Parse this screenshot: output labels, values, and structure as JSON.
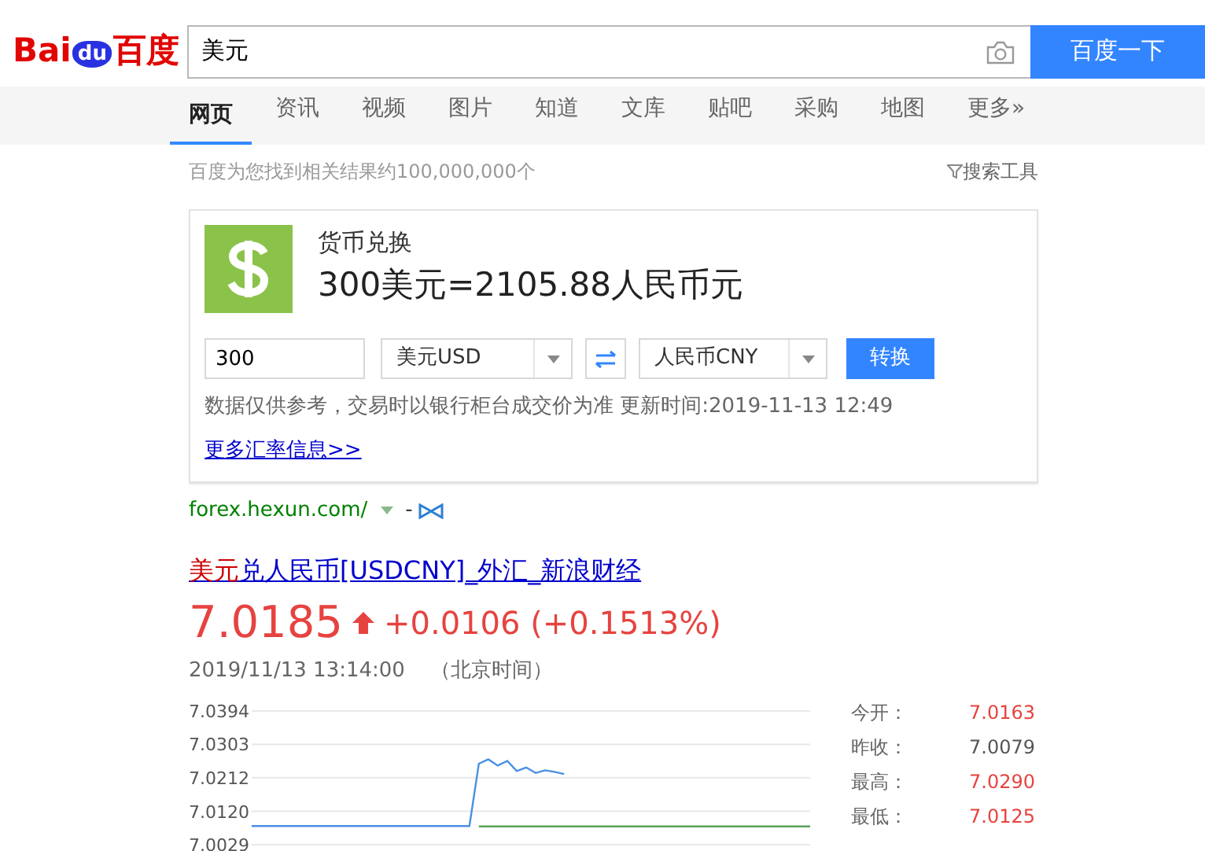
{
  "logo": {
    "parts": [
      "Bai",
      "du",
      "百度"
    ]
  },
  "search": {
    "value": "美元",
    "button": "百度一下"
  },
  "nav_tabs": [
    {
      "label": "网页",
      "selected": true
    },
    {
      "label": "资讯",
      "selected": false
    },
    {
      "label": "视频",
      "selected": false
    },
    {
      "label": "图片",
      "selected": false
    },
    {
      "label": "知道",
      "selected": false
    },
    {
      "label": "文库",
      "selected": false
    },
    {
      "label": "贴吧",
      "selected": false
    },
    {
      "label": "采购",
      "selected": false
    },
    {
      "label": "地图",
      "selected": false
    },
    {
      "label": "更多»",
      "selected": false
    }
  ],
  "result_count": "百度为您找到相关结果约100,000,000个",
  "search_tools": "搜索工具",
  "converter": {
    "title": "货币兑换",
    "result": "300美元=2105.88人民币元",
    "amount": "300",
    "from": "美元USD",
    "to": "人民币CNY",
    "button": "转换",
    "note": "数据仅供参考，交易时以银行柜台成交价为准 更新时间:2019-11-13 12:49",
    "more_link": "更多汇率信息>>"
  },
  "source": {
    "url": "forex.hexun.com/",
    "sep": "-"
  },
  "result": {
    "title": "**美元**兑人民币[USDCNY]_外汇_新浪财经",
    "price": "7.0185",
    "change": "+0.0106 (+0.1513%)",
    "time": "2019/11/13 13:14:00",
    "timezone": "（北京时间）",
    "chart_data": {
      "type": "line",
      "grid": true,
      "ylim": [
        7.0029,
        7.0394
      ],
      "yticks": [
        {
          "value": 7.0394,
          "label": "7.0394"
        },
        {
          "value": 7.0303,
          "label": "7.0303"
        },
        {
          "value": 7.0212,
          "label": "7.0212"
        },
        {
          "value": 7.012,
          "label": "7.0120"
        },
        {
          "value": 7.0029,
          "label": "7.0029"
        }
      ],
      "series": [
        {
          "color": "#4a90e2",
          "values": [
            7.008,
            7.008,
            7.008,
            7.008,
            7.008,
            7.008,
            7.008,
            7.008,
            7.008,
            7.008,
            7.008,
            7.008,
            7.008,
            7.008,
            7.008,
            7.008,
            7.008,
            7.008,
            7.008,
            7.008,
            7.008,
            7.008,
            7.008,
            7.008,
            7.025,
            7.0262,
            7.0245,
            7.0258,
            7.023,
            7.024,
            7.0225,
            7.0232,
            7.0228,
            7.0222,
            null,
            null,
            null,
            null,
            null,
            null,
            null,
            null,
            null,
            null,
            null,
            null,
            null,
            null,
            null,
            null,
            null,
            null,
            null,
            null,
            null,
            null,
            null,
            null,
            null,
            null
          ]
        },
        {
          "color": "#5aa05a",
          "values": [
            null,
            null,
            null,
            null,
            null,
            null,
            null,
            null,
            null,
            null,
            null,
            null,
            null,
            null,
            null,
            null,
            null,
            null,
            null,
            null,
            null,
            null,
            null,
            null,
            7.0079,
            7.0079,
            7.0079,
            7.0079,
            7.0079,
            7.0079,
            7.0079,
            7.0079,
            7.0079,
            7.0079,
            7.0079,
            7.0079,
            7.0079,
            7.0079,
            7.0079,
            7.0079,
            7.0079,
            7.0079,
            7.0079,
            7.0079,
            7.0079,
            7.0079,
            7.0079,
            7.0079,
            7.0079,
            7.0079,
            7.0079,
            7.0079,
            7.0079,
            7.0079,
            7.0079,
            7.0079,
            7.0079,
            7.0079,
            7.0079,
            7.0079
          ]
        }
      ]
    },
    "stats": [
      {
        "label": "今开：",
        "value": "7.0163",
        "up": true
      },
      {
        "label": "昨收：",
        "value": "7.0079",
        "up": false
      },
      {
        "label": "最高：",
        "value": "7.0290",
        "up": true
      },
      {
        "label": "最低：",
        "value": "7.0125",
        "up": true
      }
    ]
  }
}
